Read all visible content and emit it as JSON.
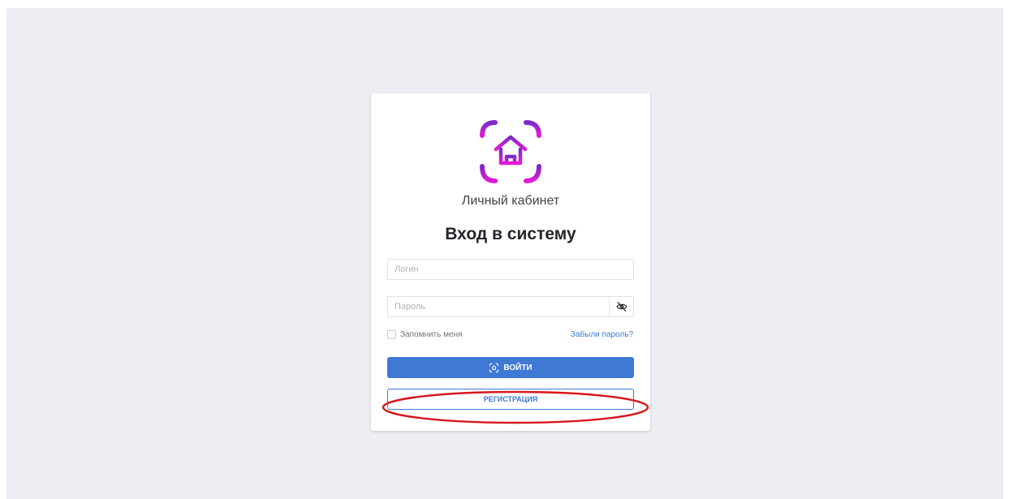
{
  "brand": {
    "name": "Личный кабинет",
    "gradient_top": "#7b2cc8",
    "gradient_bottom": "#e21ad7"
  },
  "form": {
    "title": "Вход в систему",
    "login_placeholder": "Логин",
    "password_placeholder": "Пароль",
    "password_toggle_icon": "eye-off-icon",
    "remember_label": "Запомнить меня",
    "remember_checked": false,
    "forgot_label": "Забыли пароль?",
    "submit_label": "ВОЙТИ",
    "register_label": "РЕГИСТРАЦИЯ"
  },
  "colors": {
    "accent": "#3f79d4",
    "background": "#eceef3",
    "annotation": "#d6181e"
  }
}
